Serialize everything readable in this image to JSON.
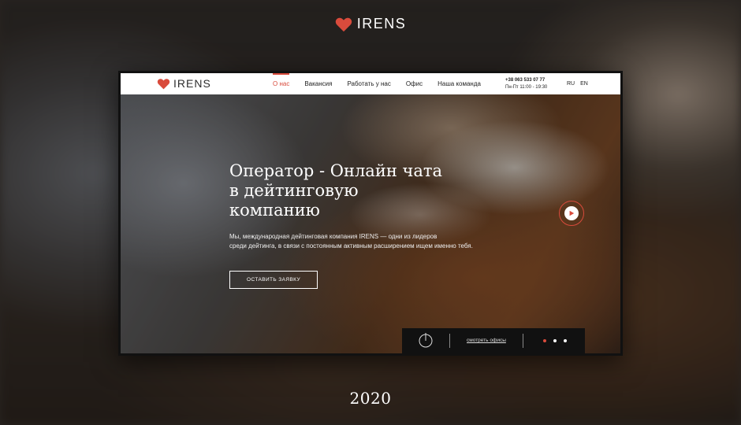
{
  "brand": {
    "name": "IRENS",
    "accent_color": "#d94b3c",
    "logo_icon": "heart-icon"
  },
  "nav": {
    "items": [
      {
        "label": "О нас",
        "active": true
      },
      {
        "label": "Вакансия",
        "active": false
      },
      {
        "label": "Работать у нас",
        "active": false
      },
      {
        "label": "Офис",
        "active": false
      },
      {
        "label": "Наша команда",
        "active": false
      }
    ],
    "phone": "+38 063 533 07 77",
    "hours": "Пн-Пт 11:00 - 19:30",
    "languages": [
      "RU",
      "EN"
    ]
  },
  "hero": {
    "title_lines": [
      "Оператор - Онлайн чата",
      "в дейтинговую",
      "компанию"
    ],
    "description_lines": [
      "Мы, международная дейтинговая компания IRENS — одни из лидеров",
      "среди дейтинга, в связи с постоянным активным расширением ищем именно тебя."
    ],
    "cta_label": "ОСТАВИТЬ ЗАЯВКУ",
    "play_icon": "play-icon"
  },
  "bottom_bar": {
    "icon": "clock-icon",
    "link_label": "смотреть офисы",
    "slides_total": 3,
    "active_slide": 1
  },
  "year": "2020"
}
